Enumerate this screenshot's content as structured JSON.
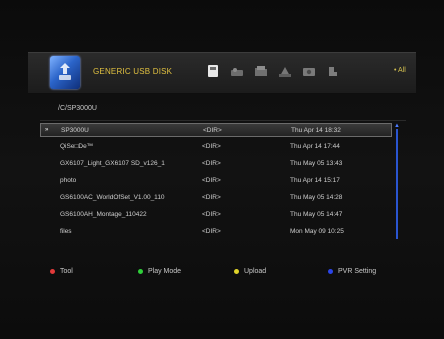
{
  "colors": {
    "red": "#e23a3a",
    "green": "#2fcf3a",
    "yellow": "#e0d42a",
    "blue": "#2b45e8"
  },
  "header": {
    "device_title": "GENERIC USB DISK",
    "filter_label": "• All",
    "icons": [
      "disk-icon",
      "music-icon",
      "folder-icon",
      "photo-icon",
      "video-icon",
      "recording-icon"
    ]
  },
  "path": "/C/SP3000U",
  "selected_marker": "»",
  "files": [
    {
      "name": "SP3000U",
      "type": "<DIR>",
      "date": "Thu Apr 14 18:32"
    },
    {
      "name": "QiSe□De™",
      "type": "<DIR>",
      "date": "Thu Apr 14 17:44"
    },
    {
      "name": "GX6107_Light_GX6107 SD_v126_1",
      "type": "<DIR>",
      "date": "Thu May 05 13:43"
    },
    {
      "name": "photo",
      "type": "<DIR>",
      "date": "Thu Apr 14 15:17"
    },
    {
      "name": "GS6100AC_WorldOfSet_V1.00_110",
      "type": "<DIR>",
      "date": "Thu May 05 14:28"
    },
    {
      "name": "GS6100AH_Montage_110422",
      "type": "<DIR>",
      "date": "Thu May 05 14:47"
    },
    {
      "name": "files",
      "type": "<DIR>",
      "date": "Mon May 09 10:25"
    }
  ],
  "footer": {
    "tool": "Tool",
    "play_mode": "Play Mode",
    "upload": "Upload",
    "pvr_setting": "PVR Setting"
  }
}
